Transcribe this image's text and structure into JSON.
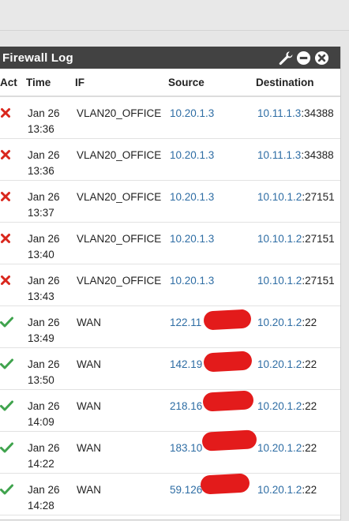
{
  "panel": {
    "title": "Firewall Log",
    "tools": [
      "wrench-icon",
      "minus-circle-icon",
      "close-circle-icon"
    ]
  },
  "columns": {
    "act": "Act",
    "time": "Time",
    "if": "IF",
    "source": "Source",
    "destination": "Destination"
  },
  "colors": {
    "header_bg": "#424242",
    "link": "#2e6da4",
    "block": "#d9261c",
    "pass": "#3fa34d",
    "redaction": "#e31b1b"
  },
  "rows": [
    {
      "action": "block",
      "date": "Jan 26",
      "time": "13:36",
      "if": "VLAN20_OFFICE",
      "source": "10.20.1.3",
      "dst_ip": "10.11.1.3",
      "dst_port": ":34388"
    },
    {
      "action": "block",
      "date": "Jan 26",
      "time": "13:36",
      "if": "VLAN20_OFFICE",
      "source": "10.20.1.3",
      "dst_ip": "10.11.1.3",
      "dst_port": ":34388"
    },
    {
      "action": "block",
      "date": "Jan 26",
      "time": "13:37",
      "if": "VLAN20_OFFICE",
      "source": "10.20.1.3",
      "dst_ip": "10.10.1.2",
      "dst_port": ":27151"
    },
    {
      "action": "block",
      "date": "Jan 26",
      "time": "13:40",
      "if": "VLAN20_OFFICE",
      "source": "10.20.1.3",
      "dst_ip": "10.10.1.2",
      "dst_port": ":27151"
    },
    {
      "action": "block",
      "date": "Jan 26",
      "time": "13:43",
      "if": "VLAN20_OFFICE",
      "source": "10.20.1.3",
      "dst_ip": "10.10.1.2",
      "dst_port": ":27151"
    },
    {
      "action": "pass",
      "date": "Jan 26",
      "time": "13:49",
      "if": "WAN",
      "source": "122.11",
      "dst_ip": "10.20.1.2",
      "dst_port": ":22"
    },
    {
      "action": "pass",
      "date": "Jan 26",
      "time": "13:50",
      "if": "WAN",
      "source": "142.19",
      "dst_ip": "10.20.1.2",
      "dst_port": ":22"
    },
    {
      "action": "pass",
      "date": "Jan 26",
      "time": "14:09",
      "if": "WAN",
      "source": "218.16",
      "dst_ip": "10.20.1.2",
      "dst_port": ":22"
    },
    {
      "action": "pass",
      "date": "Jan 26",
      "time": "14:22",
      "if": "WAN",
      "source": "183.10",
      "dst_ip": "10.20.1.2",
      "dst_port": ":22"
    },
    {
      "action": "pass",
      "date": "Jan 26",
      "time": "14:28",
      "if": "WAN",
      "source": "59.126",
      "dst_ip": "10.20.1.2",
      "dst_port": ":22"
    }
  ]
}
